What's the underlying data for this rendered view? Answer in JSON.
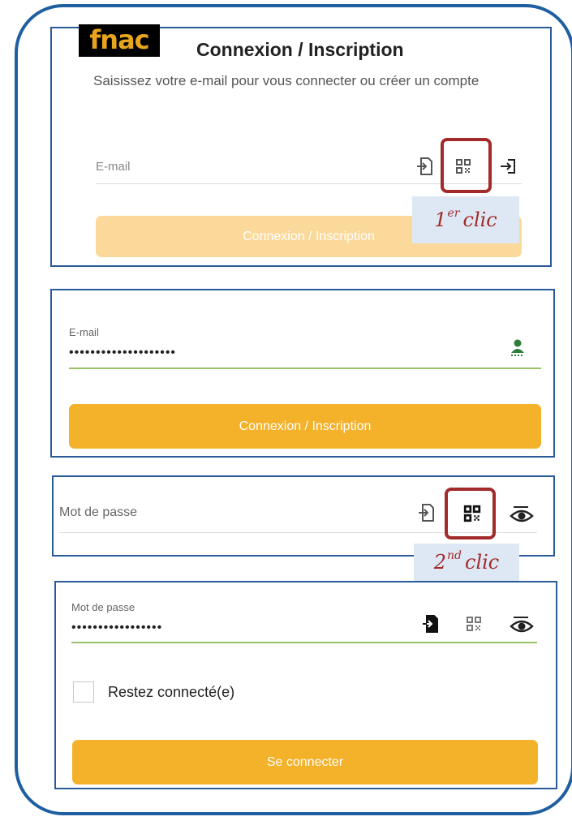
{
  "brand": {
    "logo_text": "fnac"
  },
  "screen1": {
    "title": "Connexion / Inscription",
    "subtitle": "Saisissez votre e-mail pour vous connecter ou créer un compte",
    "email_placeholder": "E-mail",
    "button_label": "Connexion / Inscription",
    "icons": [
      "autofill-icon",
      "qr-code-icon",
      "login-icon"
    ]
  },
  "annotation1": {
    "number": "1",
    "suffix": "er",
    "word": "clic"
  },
  "screen2": {
    "email_label": "E-mail",
    "email_value": "••••••••••••••••••••",
    "button_label": "Connexion / Inscription",
    "icon": "user-icon"
  },
  "screen3": {
    "password_placeholder": "Mot de passe",
    "icons": [
      "autofill-icon",
      "qr-code-icon",
      "eye-icon"
    ]
  },
  "annotation2": {
    "number": "2",
    "suffix": "nd",
    "word": "clic"
  },
  "screen4": {
    "password_label": "Mot de passe",
    "password_value": "•••••••••••••••••",
    "remember_label": "Restez connecté(e)",
    "remember_checked": false,
    "button_label": "Se connecter",
    "icons": [
      "autofill-icon",
      "qr-code-icon",
      "eye-icon"
    ]
  },
  "colors": {
    "accent": "#f4b12a",
    "accent_faded": "#fbd99a",
    "frame": "#1f5fa0",
    "highlight": "#a32a2a",
    "tag_bg": "#dde8f4",
    "logo_text": "#e7a51d"
  }
}
